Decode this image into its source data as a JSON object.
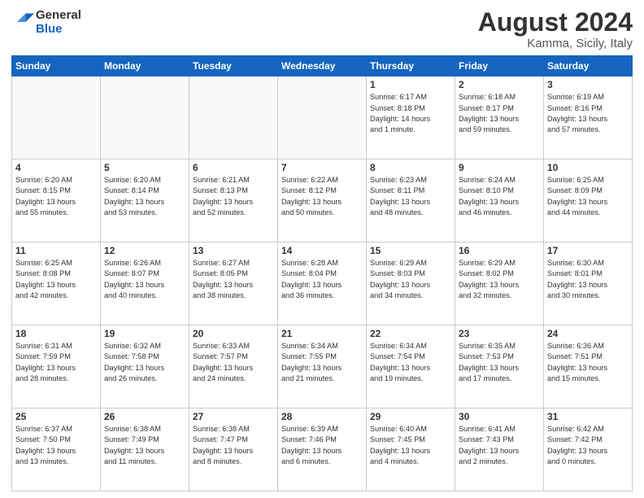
{
  "header": {
    "logo_general": "General",
    "logo_blue": "Blue",
    "month_year": "August 2024",
    "location": "Kamma, Sicily, Italy"
  },
  "weekdays": [
    "Sunday",
    "Monday",
    "Tuesday",
    "Wednesday",
    "Thursday",
    "Friday",
    "Saturday"
  ],
  "weeks": [
    [
      {
        "day": "",
        "info": ""
      },
      {
        "day": "",
        "info": ""
      },
      {
        "day": "",
        "info": ""
      },
      {
        "day": "",
        "info": ""
      },
      {
        "day": "1",
        "info": "Sunrise: 6:17 AM\nSunset: 8:18 PM\nDaylight: 14 hours\nand 1 minute."
      },
      {
        "day": "2",
        "info": "Sunrise: 6:18 AM\nSunset: 8:17 PM\nDaylight: 13 hours\nand 59 minutes."
      },
      {
        "day": "3",
        "info": "Sunrise: 6:19 AM\nSunset: 8:16 PM\nDaylight: 13 hours\nand 57 minutes."
      }
    ],
    [
      {
        "day": "4",
        "info": "Sunrise: 6:20 AM\nSunset: 8:15 PM\nDaylight: 13 hours\nand 55 minutes."
      },
      {
        "day": "5",
        "info": "Sunrise: 6:20 AM\nSunset: 8:14 PM\nDaylight: 13 hours\nand 53 minutes."
      },
      {
        "day": "6",
        "info": "Sunrise: 6:21 AM\nSunset: 8:13 PM\nDaylight: 13 hours\nand 52 minutes."
      },
      {
        "day": "7",
        "info": "Sunrise: 6:22 AM\nSunset: 8:12 PM\nDaylight: 13 hours\nand 50 minutes."
      },
      {
        "day": "8",
        "info": "Sunrise: 6:23 AM\nSunset: 8:11 PM\nDaylight: 13 hours\nand 48 minutes."
      },
      {
        "day": "9",
        "info": "Sunrise: 6:24 AM\nSunset: 8:10 PM\nDaylight: 13 hours\nand 46 minutes."
      },
      {
        "day": "10",
        "info": "Sunrise: 6:25 AM\nSunset: 8:09 PM\nDaylight: 13 hours\nand 44 minutes."
      }
    ],
    [
      {
        "day": "11",
        "info": "Sunrise: 6:25 AM\nSunset: 8:08 PM\nDaylight: 13 hours\nand 42 minutes."
      },
      {
        "day": "12",
        "info": "Sunrise: 6:26 AM\nSunset: 8:07 PM\nDaylight: 13 hours\nand 40 minutes."
      },
      {
        "day": "13",
        "info": "Sunrise: 6:27 AM\nSunset: 8:05 PM\nDaylight: 13 hours\nand 38 minutes."
      },
      {
        "day": "14",
        "info": "Sunrise: 6:28 AM\nSunset: 8:04 PM\nDaylight: 13 hours\nand 36 minutes."
      },
      {
        "day": "15",
        "info": "Sunrise: 6:29 AM\nSunset: 8:03 PM\nDaylight: 13 hours\nand 34 minutes."
      },
      {
        "day": "16",
        "info": "Sunrise: 6:29 AM\nSunset: 8:02 PM\nDaylight: 13 hours\nand 32 minutes."
      },
      {
        "day": "17",
        "info": "Sunrise: 6:30 AM\nSunset: 8:01 PM\nDaylight: 13 hours\nand 30 minutes."
      }
    ],
    [
      {
        "day": "18",
        "info": "Sunrise: 6:31 AM\nSunset: 7:59 PM\nDaylight: 13 hours\nand 28 minutes."
      },
      {
        "day": "19",
        "info": "Sunrise: 6:32 AM\nSunset: 7:58 PM\nDaylight: 13 hours\nand 26 minutes."
      },
      {
        "day": "20",
        "info": "Sunrise: 6:33 AM\nSunset: 7:57 PM\nDaylight: 13 hours\nand 24 minutes."
      },
      {
        "day": "21",
        "info": "Sunrise: 6:34 AM\nSunset: 7:55 PM\nDaylight: 13 hours\nand 21 minutes."
      },
      {
        "day": "22",
        "info": "Sunrise: 6:34 AM\nSunset: 7:54 PM\nDaylight: 13 hours\nand 19 minutes."
      },
      {
        "day": "23",
        "info": "Sunrise: 6:35 AM\nSunset: 7:53 PM\nDaylight: 13 hours\nand 17 minutes."
      },
      {
        "day": "24",
        "info": "Sunrise: 6:36 AM\nSunset: 7:51 PM\nDaylight: 13 hours\nand 15 minutes."
      }
    ],
    [
      {
        "day": "25",
        "info": "Sunrise: 6:37 AM\nSunset: 7:50 PM\nDaylight: 13 hours\nand 13 minutes."
      },
      {
        "day": "26",
        "info": "Sunrise: 6:38 AM\nSunset: 7:49 PM\nDaylight: 13 hours\nand 11 minutes."
      },
      {
        "day": "27",
        "info": "Sunrise: 6:38 AM\nSunset: 7:47 PM\nDaylight: 13 hours\nand 8 minutes."
      },
      {
        "day": "28",
        "info": "Sunrise: 6:39 AM\nSunset: 7:46 PM\nDaylight: 13 hours\nand 6 minutes."
      },
      {
        "day": "29",
        "info": "Sunrise: 6:40 AM\nSunset: 7:45 PM\nDaylight: 13 hours\nand 4 minutes."
      },
      {
        "day": "30",
        "info": "Sunrise: 6:41 AM\nSunset: 7:43 PM\nDaylight: 13 hours\nand 2 minutes."
      },
      {
        "day": "31",
        "info": "Sunrise: 6:42 AM\nSunset: 7:42 PM\nDaylight: 13 hours\nand 0 minutes."
      }
    ]
  ]
}
